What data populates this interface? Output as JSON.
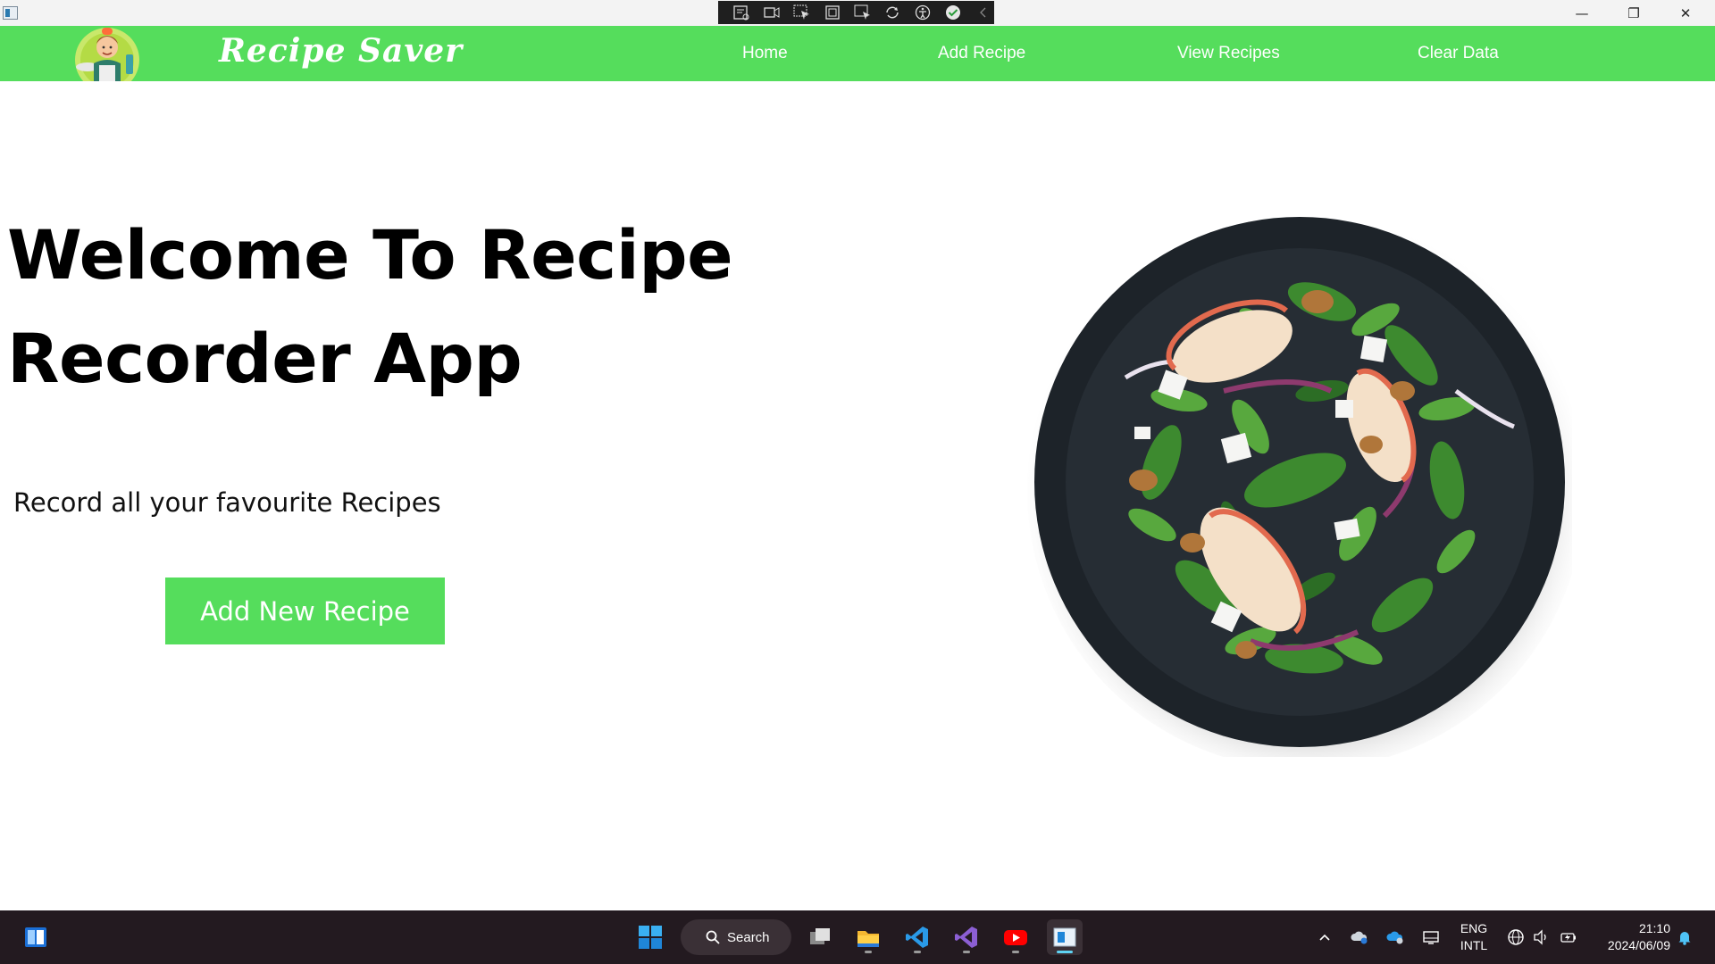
{
  "window": {
    "controls": {
      "minimize": "—",
      "maximize": "❐",
      "close": "✕"
    }
  },
  "navbar": {
    "brand": "Recipe Saver",
    "links": [
      "Home",
      "Add Recipe",
      "View Recipes",
      "Clear Data"
    ]
  },
  "hero": {
    "title_line1": "Welcome To Recipe",
    "title_line2": "Recorder App",
    "subtitle": "Record all your favourite Recipes",
    "cta_label": "Add New Recipe"
  },
  "taskbar": {
    "search_label": "Search",
    "language": "ENG",
    "layout": "INTL",
    "time": "21:10",
    "date": "2024/06/09",
    "apps": [
      "widgets-icon",
      "start-icon",
      "task-view-icon",
      "file-explorer-icon",
      "vscode-icon",
      "visual-studio-icon",
      "youtube-icon",
      "active-app-icon"
    ]
  },
  "colors": {
    "accent_green": "#55dd5c",
    "taskbar_bg": "#231a20",
    "plate": "#20262c"
  }
}
